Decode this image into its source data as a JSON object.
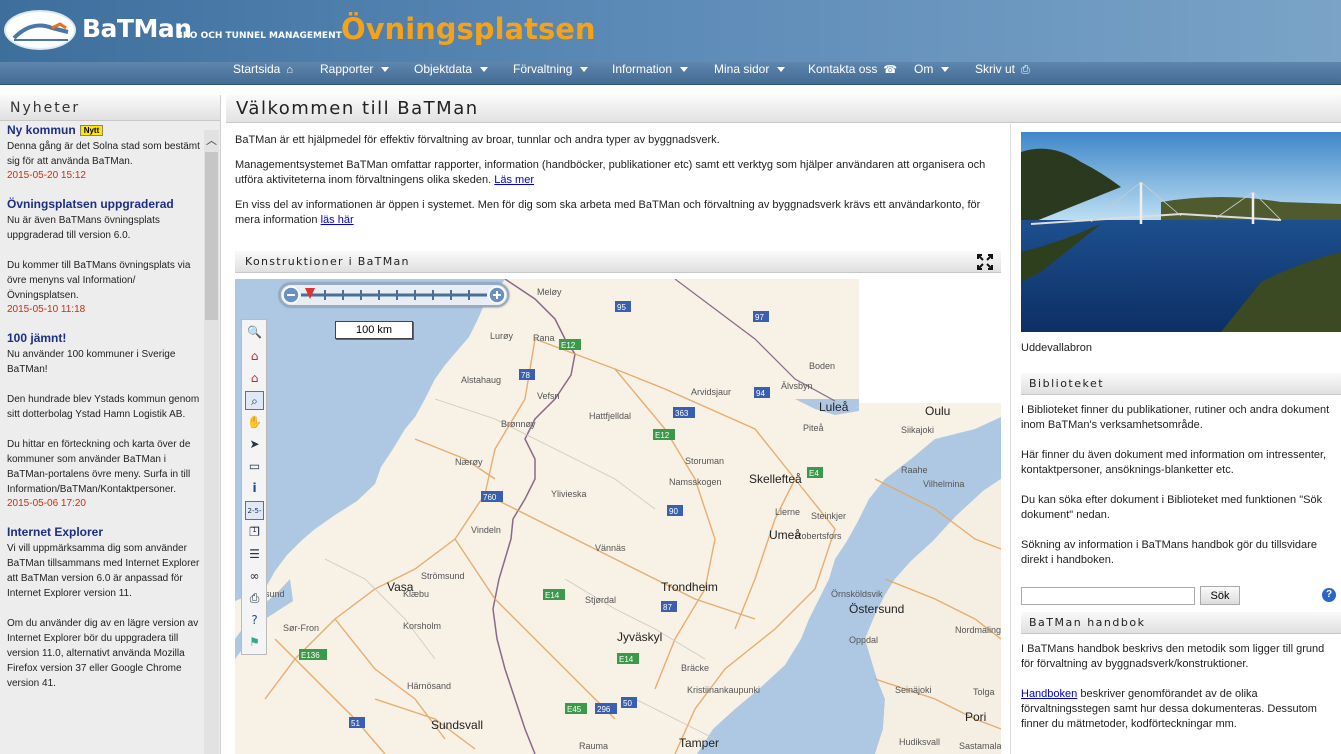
{
  "header": {
    "brand": "BaTMan",
    "brand_subtitle": "BRO OCH TUNNEL MANAGEMENT",
    "site_name": "Övningsplatsen"
  },
  "nav": [
    {
      "label": "Startsida",
      "icon": "home-icon"
    },
    {
      "label": "Rapporter",
      "icon": "caret"
    },
    {
      "label": "Objektdata",
      "icon": "caret"
    },
    {
      "label": "Förvaltning",
      "icon": "caret"
    },
    {
      "label": "Information",
      "icon": "caret"
    },
    {
      "label": "Mina sidor",
      "icon": "caret"
    },
    {
      "label": "Kontakta oss",
      "icon": "phone-icon"
    },
    {
      "label": "Om",
      "icon": "caret"
    },
    {
      "label": "Skriv ut",
      "icon": "printer-icon"
    }
  ],
  "news": {
    "title": "Nyheter",
    "items": [
      {
        "title": "Ny kommun",
        "badge": "Nytt",
        "paragraphs": [
          "Denna gång är det Solna stad som bestämt sig för att använda BaTMan."
        ],
        "date": "2015-05-20 15:12"
      },
      {
        "title": "Övningsplatsen uppgraderad",
        "badge": "",
        "paragraphs": [
          "Nu är även BaTMans övningsplats uppgraderad till version 6.0.",
          "Du kommer till BaTMans övningsplats via övre menyns val Information/Övningsplatsen."
        ],
        "date": "2015-05-10 11:18"
      },
      {
        "title": "100 jämnt!",
        "badge": "",
        "paragraphs": [
          "Nu använder 100 kommuner i Sverige BaTMan!",
          "Den hundrade blev Ystads kommun genom sitt dotterbolag Ystad Hamn Logistik AB.",
          "Du hittar en förteckning och karta över de kommuner som använder BaTMan i BaTMan-portalens övre meny. Surfa in till Information/BaTMan/Kontaktpersoner."
        ],
        "date": "2015-05-06 17:20"
      },
      {
        "title": "Internet Explorer",
        "badge": "",
        "paragraphs": [
          "Vi vill uppmärksamma dig som använder BaTMan tillsammans med Internet Explorer att BaTMan version 6.0 är anpassad för Internet Explorer version 11.",
          "Om du använder dig av en lägre version av Internet Explorer bör du uppgradera till version 11.0, alternativt använda Mozilla Firefox version 37 eller Google Chrome version 41."
        ],
        "date": ""
      }
    ]
  },
  "main": {
    "title": "Välkommen till BaTMan",
    "p1": "BaTMan är ett hjälpmedel för effektiv förvaltning av broar, tunnlar och andra typer av byggnadsverk.",
    "p2": "Managementsystemet BaTMan omfattar rapporter, information (handböcker, publikationer etc) samt ett verktyg som hjälper användaren att organisera och utföra aktiviteterna inom förvaltningens olika skeden.",
    "p2_link": "Läs mer",
    "p3": "En viss del av informationen är öppen i systemet. Men för dig som ska arbeta med BaTMan och förvaltning av byggnadsverk krävs ett användarkonto, för mera information",
    "p3_link": "läs här",
    "map_title": "Konstruktioner i BaTMan",
    "scale": "100 km",
    "places": [
      "Meløy",
      "Rana",
      "Boden",
      "Luleå",
      "Oulu",
      "Lurøy",
      "Arvidsjaur",
      "Älvsbyn",
      "Piteå",
      "Siikajoki",
      "Alstahaug",
      "Vefsn",
      "Hattfjelldal",
      "Raahe",
      "Brønnøy",
      "Storuman",
      "Skellefteå",
      "Nærøy",
      "Namsskogen",
      "Vilhelmina",
      "Ylivieska",
      "Lierne",
      "Vindeln",
      "Steinkjer",
      "Robertsfors",
      "Umeå",
      "Vännäs",
      "Strömsund",
      "Trondheim",
      "Örnsköldsvik",
      "Vasa",
      "Klæbu",
      "Stjørdal",
      "Östersund",
      "Nordmaling",
      "Korsholm",
      "Jyväskyl",
      "Oppdal",
      "Bräcke",
      "Seinäjoki",
      "Härnösand",
      "Kristiinankaupunki",
      "Tolga",
      "Sundsvall",
      "Pori",
      "Tamper",
      "Hudiksvall",
      "Sastamala",
      "Rauma",
      "Sør-Fron",
      "ansund"
    ],
    "roads": [
      "95",
      "97",
      "E12",
      "78",
      "94",
      "363",
      "E12",
      "E4",
      "760",
      "90",
      "E14",
      "87",
      "E14",
      "E136",
      "E45",
      "296",
      "50",
      "51"
    ]
  },
  "right": {
    "caption": "Uddevallabron",
    "lib_title": "Biblioteket",
    "lib_paragraphs": [
      "I Biblioteket finner du publikationer, rutiner och andra dokument inom BaTMan's verksamhetsområde.",
      "Här finner du även dokument med information om intressenter, kontaktpersoner, ansöknings-blanketter etc.",
      "Du kan söka efter dokument i Biblioteket med funktionen \"Sök dokument\" nedan.",
      "Sökning av information i BaTMans handbok gör du tillsvidare direkt i handboken."
    ],
    "search_button": "Sök",
    "help": "?",
    "handbook_title": "BaTMan handbok",
    "handbook_p1": "I BaTMans handbok beskrivs den metodik som ligger till grund för förvaltning av byggnadsverk/konstruktioner.",
    "handbook_link": "Handboken",
    "handbook_p2": "beskriver genomförandet av de olika förvaltningsstegen samt hur dessa dokumenteras. Dessutom finner du mätmetoder, kodförteckningar mm."
  },
  "colors": {
    "accent": "#f5a21b",
    "nav": "#4f77a0",
    "link": "#0000cc",
    "date": "#c83010",
    "news_title": "#1a2f86"
  }
}
